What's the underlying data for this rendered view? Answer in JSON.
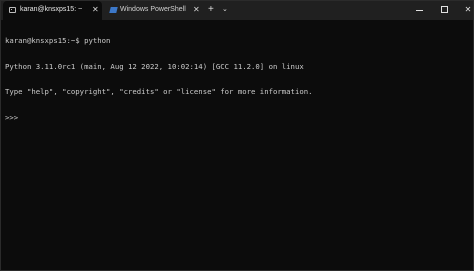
{
  "tabs": [
    {
      "label": "karan@knsxps15: ~",
      "close": "✕",
      "active": true,
      "icon": "terminal-icon"
    },
    {
      "label": "Windows PowerShell",
      "close": "✕",
      "active": false,
      "icon": "powershell-icon"
    }
  ],
  "toolbar": {
    "new_tab": "+",
    "dropdown": "⌄"
  },
  "window_controls": {
    "minimize": "minimize",
    "maximize": "maximize",
    "close": "✕"
  },
  "terminal": {
    "lines": [
      "karan@knsxps15:~$ python",
      "Python 3.11.0rc1 (main, Aug 12 2022, 10:02:14) [GCC 11.2.0] on linux",
      "Type \"help\", \"copyright\", \"credits\" or \"license\" for more information.",
      ">>> "
    ]
  },
  "colors": {
    "background": "#0c0c0c",
    "titlebar": "#202020",
    "text": "#cccccc"
  }
}
